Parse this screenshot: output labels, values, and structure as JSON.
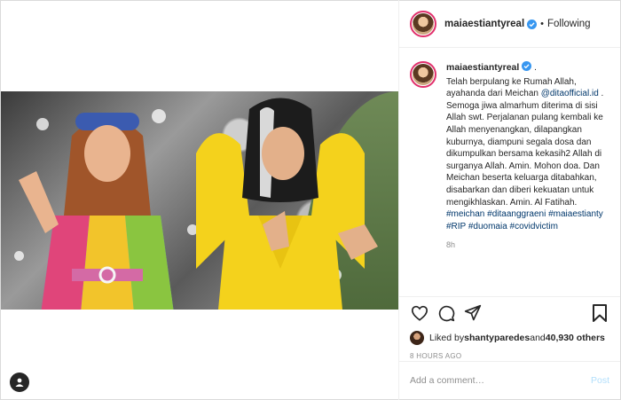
{
  "header": {
    "username": "maiaestiantyreal",
    "separator": "•",
    "follow_status": "Following"
  },
  "caption": {
    "username": "maiaestiantyreal",
    "after_name": " .",
    "line1": "Telah berpulang ke Rumah Allah, ayahanda dari Meichan ",
    "mention": "@ditaofficial.id",
    "line2": " . Semoga jiwa almarhum diterima di sisi Allah swt. Perjalanan pulang kembali ke Allah menyenangkan, dilapangkan kuburnya, diampuni segala dosa dan dikumpulkan bersama kekasih2 Allah di surganya Allah. Amin. Mohon doa. Dan Meichan beserta keluarga ditabahkan, disabarkan dan diberi kekuatan untuk mengikhlaskan. Amin. Al Fatihah.",
    "hashtags": "#meichan #ditaanggraeni #maiaestianty #RIP #duomaia #covidvictim",
    "time": "8h"
  },
  "likes": {
    "prefix": "Liked by ",
    "user": "shantyparedes",
    "middle": " and ",
    "count": "40,930 others"
  },
  "post_age": "8 HOURS AGO",
  "comment_box": {
    "placeholder": "Add a comment…",
    "post_label": "Post"
  },
  "colors": {
    "verified": "#3897f0",
    "link": "#00376b",
    "post_disabled": "#b2dffc",
    "story_ring": "#e1306c"
  },
  "icons": {
    "like": "heart-icon",
    "comment": "comment-icon",
    "share": "paper-plane-icon",
    "save": "bookmark-icon",
    "tag": "user-tag-icon"
  }
}
